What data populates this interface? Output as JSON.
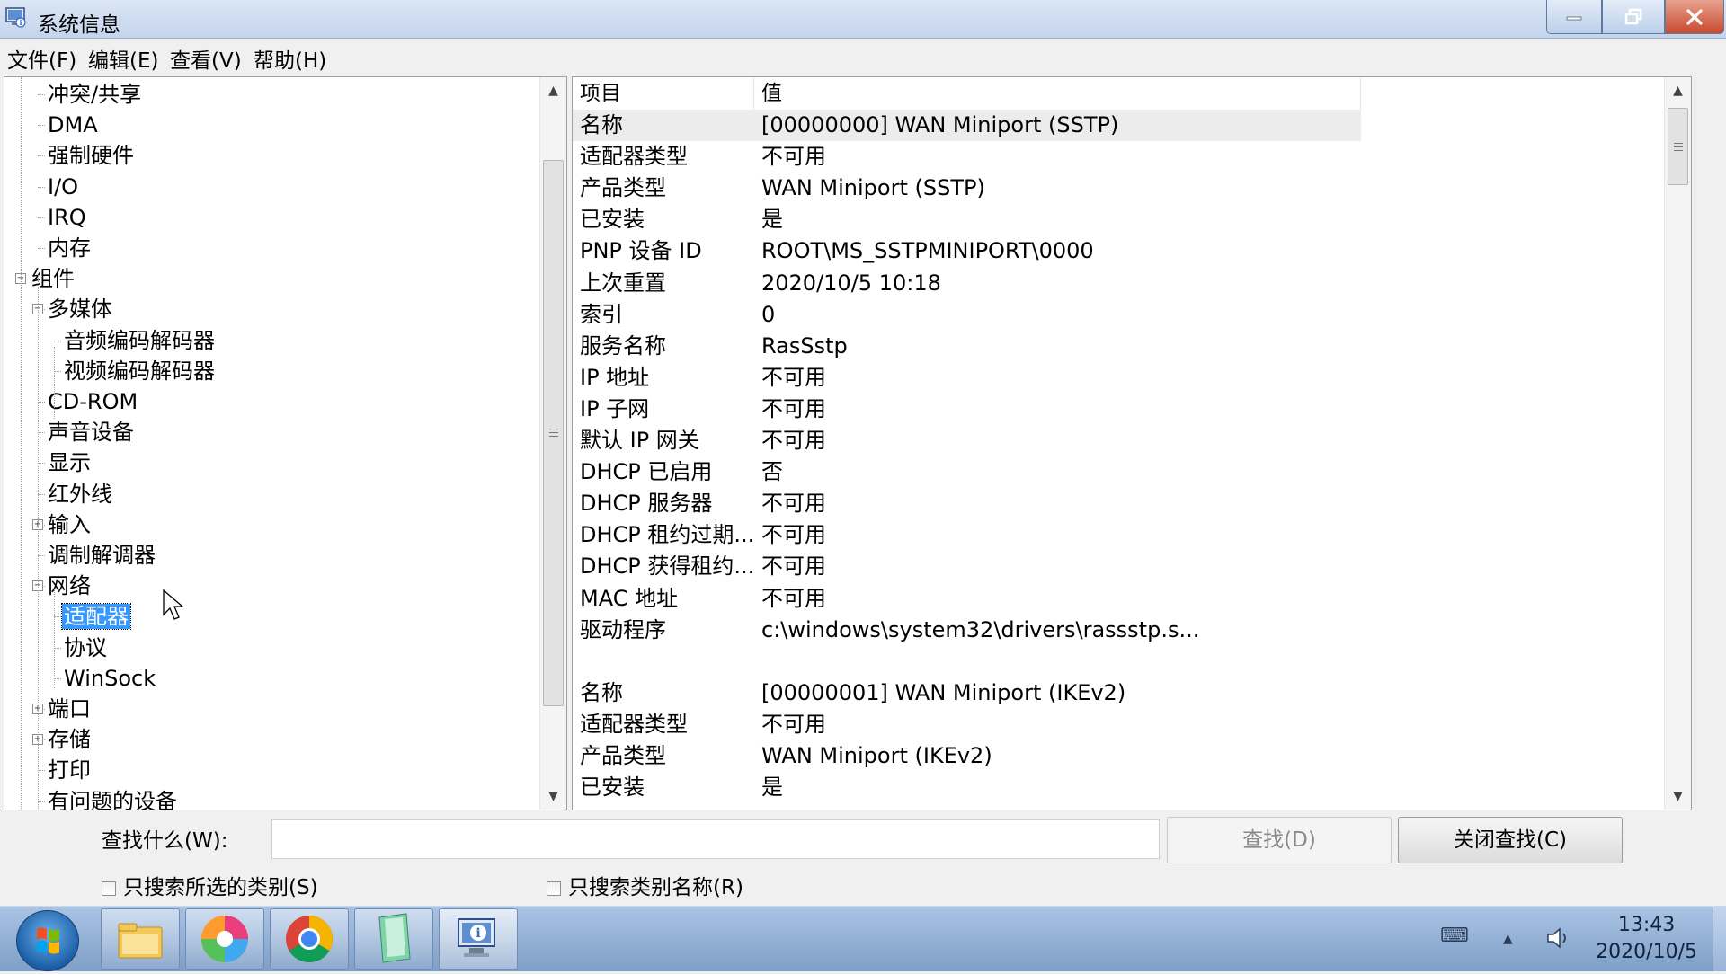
{
  "window": {
    "title": "系统信息",
    "menu": [
      "文件(F)",
      "编辑(E)",
      "查看(V)",
      "帮助(H)"
    ]
  },
  "tree": [
    {
      "label": "冲突/共享"
    },
    {
      "label": "DMA"
    },
    {
      "label": "强制硬件"
    },
    {
      "label": "I/O"
    },
    {
      "label": "IRQ"
    },
    {
      "label": "内存"
    },
    {
      "label": "组件",
      "toggle": "−"
    },
    {
      "label": "多媒体",
      "toggle": "−"
    },
    {
      "label": "音频编码解码器"
    },
    {
      "label": "视频编码解码器"
    },
    {
      "label": "CD-ROM"
    },
    {
      "label": "声音设备"
    },
    {
      "label": "显示"
    },
    {
      "label": "红外线"
    },
    {
      "label": "输入",
      "toggle": "+"
    },
    {
      "label": "调制解调器"
    },
    {
      "label": "网络",
      "toggle": "−"
    },
    {
      "label": "适配器",
      "selected": true
    },
    {
      "label": "协议"
    },
    {
      "label": "WinSock"
    },
    {
      "label": "端口",
      "toggle": "+"
    },
    {
      "label": "存储",
      "toggle": "+"
    },
    {
      "label": "打印"
    },
    {
      "label": "有问题的设备"
    }
  ],
  "table": {
    "headers": [
      "项目",
      "值"
    ],
    "rows": [
      [
        "名称",
        "[00000000] WAN Miniport (SSTP)"
      ],
      [
        "适配器类型",
        "不可用"
      ],
      [
        "产品类型",
        "WAN Miniport (SSTP)"
      ],
      [
        "已安装",
        "是"
      ],
      [
        "PNP 设备 ID",
        "ROOT\\MS_SSTPMINIPORT\\0000"
      ],
      [
        "上次重置",
        "2020/10/5 10:18"
      ],
      [
        "索引",
        "0"
      ],
      [
        "服务名称",
        "RasSstp"
      ],
      [
        "IP 地址",
        "不可用"
      ],
      [
        "IP 子网",
        "不可用"
      ],
      [
        "默认 IP 网关",
        "不可用"
      ],
      [
        "DHCP 已启用",
        "否"
      ],
      [
        "DHCP 服务器",
        "不可用"
      ],
      [
        "DHCP 租约过期...",
        "不可用"
      ],
      [
        "DHCP 获得租约...",
        "不可用"
      ],
      [
        "MAC 地址",
        "不可用"
      ],
      [
        "驱动程序",
        "c:\\windows\\system32\\drivers\\rassstp.s..."
      ],
      [
        "",
        ""
      ],
      [
        "名称",
        "[00000001] WAN Miniport (IKEv2)"
      ],
      [
        "适配器类型",
        "不可用"
      ],
      [
        "产品类型",
        "WAN Miniport (IKEv2)"
      ],
      [
        "已安装",
        "是"
      ]
    ]
  },
  "find": {
    "label": "查找什么(W):",
    "value": "",
    "find_button": "查找(D)",
    "close_button": "关闭查找(C)",
    "checkbox_selected_category": "只搜索所选的类别(S)",
    "checkbox_category_names": "只搜索类别名称(R)"
  },
  "taskbar": {
    "time": "13:43",
    "date": "2020/10/5",
    "apps": [
      "file-explorer",
      "pinwheel-app",
      "chrome",
      "notepad-app",
      "system-info"
    ]
  }
}
